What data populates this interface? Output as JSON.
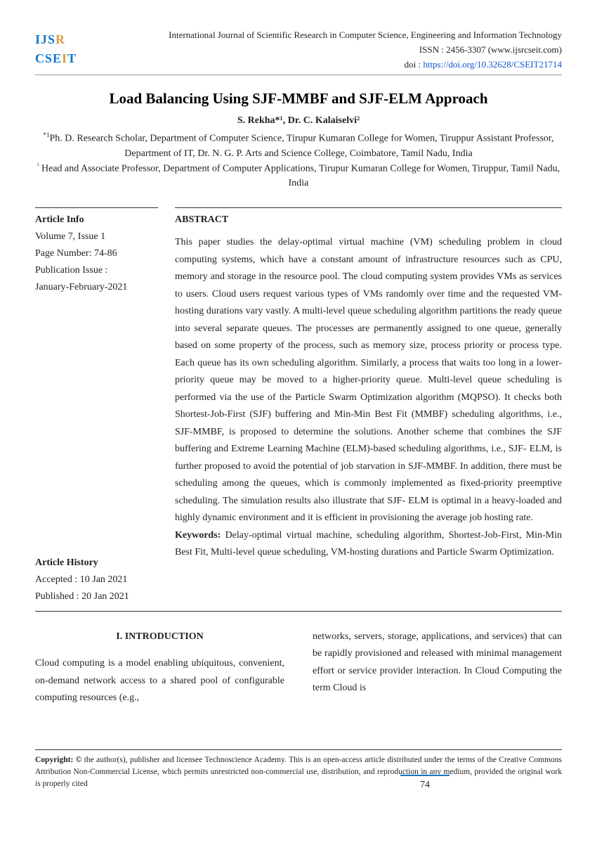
{
  "header": {
    "journal_title": "International Journal of Scientific Research in Computer Science, Engineering and Information Technology",
    "issn": "ISSN : 2456-3307 (www.ijsrcseit.com)",
    "doi_label": "doi : ",
    "doi": "https://doi.org/10.32628/CSEIT21714"
  },
  "paper": {
    "title": "Load Balancing Using SJF-MMBF and SJF-ELM Approach",
    "authors": "S. Rekha*¹, Dr. C. Kalaiselvi²",
    "aff1_sup": "*1",
    "aff1": "Ph. D. Research Scholar, Department of Computer Science, Tirupur Kumaran College for Women, Tiruppur Assistant Professor, Department of IT, Dr. N. G. P. Arts and Science College, Coimbatore, Tamil Nadu, India",
    "aff2_sup": "²",
    "aff2": " Head and Associate Professor, Department of Computer Applications, Tirupur Kumaran College for Women, Tiruppur, Tamil Nadu, India"
  },
  "article_info": {
    "heading": "Article Info",
    "volume": "Volume 7, Issue 1",
    "pages": "Page Number: 74-86",
    "pub_issue_label": "Publication Issue :",
    "pub_issue": "January-February-2021"
  },
  "article_history": {
    "heading": "Article History",
    "accepted": "Accepted : 10 Jan 2021",
    "published": "Published : 20 Jan 2021"
  },
  "abstract": {
    "heading": "ABSTRACT",
    "body": "This paper studies the delay-optimal virtual machine (VM) scheduling problem in cloud computing systems, which have a constant amount of infrastructure resources such as CPU, memory and storage in the resource pool. The cloud computing system provides VMs as services to users. Cloud users request various types of VMs randomly over time and the requested VM-hosting durations vary vastly. A multi-level queue scheduling algorithm partitions the ready queue into several separate queues. The processes are permanently assigned to one queue, generally based on some property of the process, such as memory size, process priority or process type. Each queue has its own scheduling algorithm. Similarly, a process that waits too long in a lower-priority queue may be moved to a higher-priority queue. Multi-level queue scheduling is performed via the use of the Particle Swarm Optimization algorithm (MQPSO). It checks both Shortest-Job-First (SJF) buffering and Min-Min Best Fit (MMBF) scheduling algorithms, i.e., SJF-MMBF, is proposed to determine the solutions. Another scheme that combines the SJF buffering and Extreme Learning Machine (ELM)-based scheduling algorithms, i.e., SJF- ELM, is further proposed to avoid the potential of job starvation in SJF-MMBF. In addition, there must be scheduling among the queues, which is commonly implemented as fixed-priority preemptive scheduling. The simulation results also illustrate that SJF- ELM is optimal in a heavy-loaded and highly dynamic environment and it is efficient in provisioning the average job hosting rate.",
    "keywords_label": "Keywords: ",
    "keywords": "Delay-optimal virtual machine, scheduling algorithm, Shortest-Job-First, Min-Min Best Fit, Multi-level queue scheduling, VM-hosting durations and Particle Swarm Optimization."
  },
  "intro": {
    "heading": "I.    INTRODUCTION",
    "left": "Cloud computing is a model enabling ubiquitous, convenient, on-demand network access to a shared pool of configurable computing resources (e.g.,",
    "right": "networks, servers, storage, applications, and services) that can be rapidly provisioned and released with minimal management effort or service provider interaction. In Cloud Computing the term Cloud is"
  },
  "footer": {
    "copyright_label": "Copyright: ©",
    "copyright": " the author(s), publisher and licensee Technoscience Academy. This is an open-access article distributed under the terms of the Creative Commons Attribution Non-Commercial License, which permits unrestricted non-commercial use, distribution, and reproduction in any medium, provided the original work is properly cited",
    "page": "74"
  }
}
